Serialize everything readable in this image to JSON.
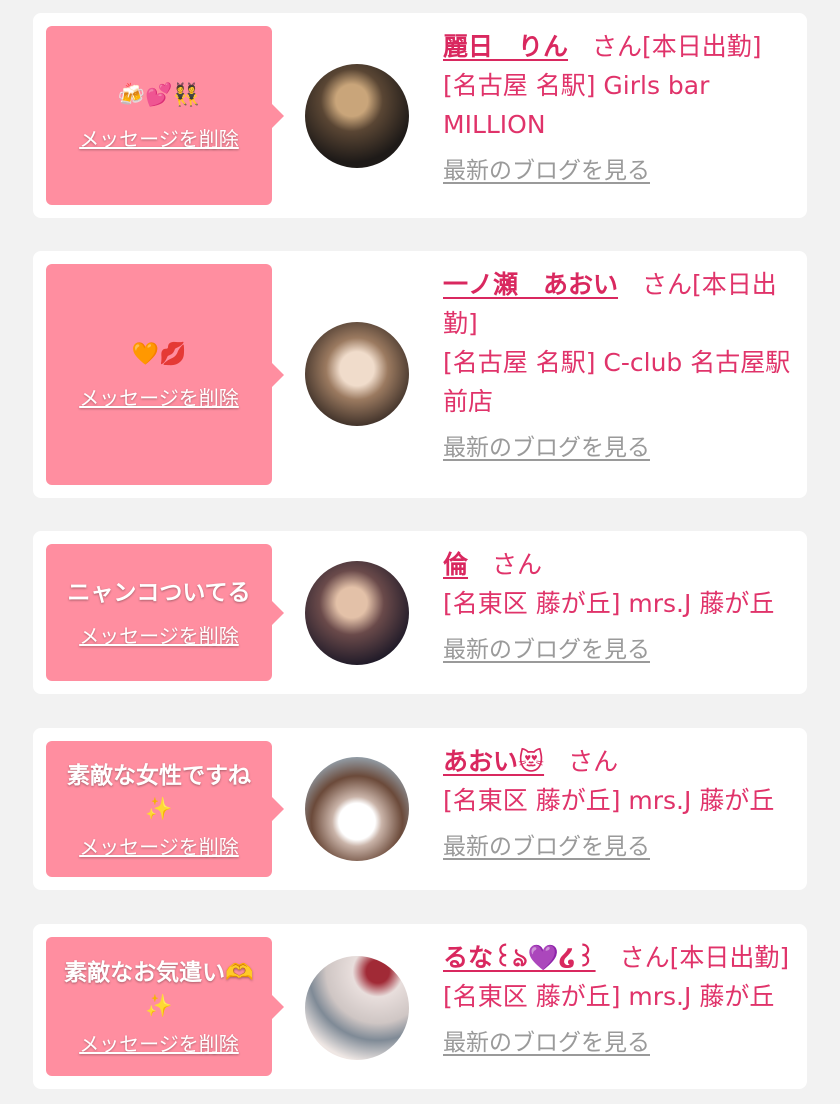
{
  "delete_label": "メッセージを削除",
  "blog_label": "最新のブログを見る",
  "san_label": "さん",
  "cards": [
    {
      "message": "",
      "emoji": "🍻💕👯",
      "name": "麗日　りん",
      "status": "[本日出勤]",
      "shop": "[名古屋 名駅] Girls bar MILLION",
      "avatar_colors": [
        "#2a2522",
        "#b9986a"
      ]
    },
    {
      "message": "",
      "emoji": "🧡💋",
      "name": "一ノ瀬　あおい",
      "status": "[本日出勤]",
      "shop": "[名古屋 名駅] C-club 名古屋駅前店",
      "avatar_colors": [
        "#6b5a4e",
        "#e9d4c2"
      ]
    },
    {
      "message": "ニャンコついてる",
      "emoji": "",
      "name": "倫",
      "status": "",
      "shop": "[名東区 藤が丘] mrs.J 藤が丘",
      "avatar_colors": [
        "#2b2236",
        "#c8a08a"
      ]
    },
    {
      "message": "素敵な女性ですね",
      "emoji": "✨",
      "name": "あおい😻",
      "status": "",
      "shop": "[名東区 藤が丘] mrs.J 藤が丘",
      "avatar_colors": [
        "#6b4a3a",
        "#9fb7c8"
      ]
    },
    {
      "message": "素敵なお気遣い🫶",
      "emoji": "✨",
      "name": "るな꒰ঌ💜໒꒱",
      "status": "[本日出勤]",
      "shop": "[名東区 藤が丘] mrs.J 藤が丘",
      "avatar_colors": [
        "#cfc6c4",
        "#8a2a33"
      ]
    }
  ]
}
